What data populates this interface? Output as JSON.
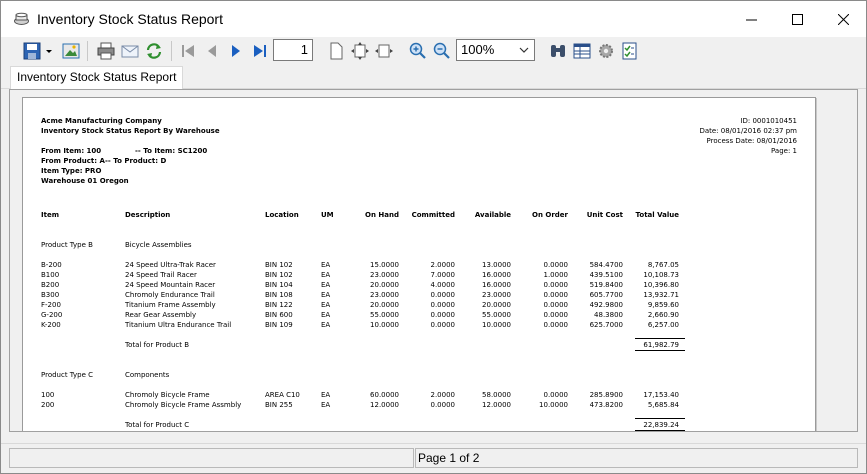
{
  "window": {
    "title": "Inventory Stock Status Report"
  },
  "toolbar": {
    "page_number": "1",
    "zoom": "100%"
  },
  "tab": {
    "label": "Inventory Stock Status Report"
  },
  "report": {
    "company": "Acme Manufacturing Company",
    "report_title": "Inventory Stock Status Report By Warehouse",
    "filters": {
      "from_item": "From Item: 100",
      "to_item": "-- To Item: SC1200",
      "from_product": "From Product: A",
      "to_product": "-- To Product: D",
      "item_type": "Item Type: PRO",
      "warehouse": "Warehouse 01 Oregon"
    },
    "meta": {
      "id": "ID: 0001010451",
      "date": "Date: 08/01/2016 02:37 pm",
      "process_date": "Process Date: 08/01/2016",
      "page": "Page: 1"
    },
    "columns": [
      "Item",
      "Description",
      "Location",
      "UM",
      "On Hand",
      "Committed",
      "Available",
      "On Order",
      "Unit Cost",
      "Total Value"
    ],
    "groups": [
      {
        "type": "Product Type B",
        "name": "Bicycle Assemblies",
        "rows": [
          [
            "B-200",
            "24 Speed Ultra-Trak Racer",
            "BIN 102",
            "EA",
            "15.0000",
            "2.0000",
            "13.0000",
            "0.0000",
            "584.4700",
            "8,767.05"
          ],
          [
            "B100",
            "24 Speed Trail Racer",
            "BIN 102",
            "EA",
            "23.0000",
            "7.0000",
            "16.0000",
            "1.0000",
            "439.5100",
            "10,108.73"
          ],
          [
            "B200",
            "24 Speed Mountain Racer",
            "BIN 104",
            "EA",
            "20.0000",
            "4.0000",
            "16.0000",
            "0.0000",
            "519.8400",
            "10,396.80"
          ],
          [
            "B300",
            "Chromoly Endurance Trail",
            "BIN 108",
            "EA",
            "23.0000",
            "0.0000",
            "23.0000",
            "0.0000",
            "605.7700",
            "13,932.71"
          ],
          [
            "F-200",
            "Titanium Frame Assembly",
            "BIN 122",
            "EA",
            "20.0000",
            "0.0000",
            "20.0000",
            "0.0000",
            "492.9800",
            "9,859.60"
          ],
          [
            "G-200",
            "Rear Gear Assembly",
            "BIN 600",
            "EA",
            "55.0000",
            "0.0000",
            "55.0000",
            "0.0000",
            "48.3800",
            "2,660.90"
          ],
          [
            "K-200",
            "Titanium Ultra Endurance Trail",
            "BIN 109",
            "EA",
            "10.0000",
            "0.0000",
            "10.0000",
            "0.0000",
            "625.7000",
            "6,257.00"
          ]
        ],
        "total_label": "Total for Product B",
        "total_value": "61,982.79"
      },
      {
        "type": "Product Type C",
        "name": "Components",
        "rows": [
          [
            "100",
            "Chromoly Bicycle Frame",
            "AREA C10",
            "EA",
            "60.0000",
            "2.0000",
            "58.0000",
            "0.0000",
            "285.8900",
            "17,153.40"
          ],
          [
            "200",
            "Chromoly Bicycle Frame Assmbly",
            "BIN 255",
            "EA",
            "12.0000",
            "0.0000",
            "12.0000",
            "10.0000",
            "473.8200",
            "5,685.84"
          ]
        ],
        "total_label": "Total for Product C",
        "total_value": "22,839.24"
      }
    ]
  },
  "status": {
    "page": "Page 1 of 2"
  }
}
